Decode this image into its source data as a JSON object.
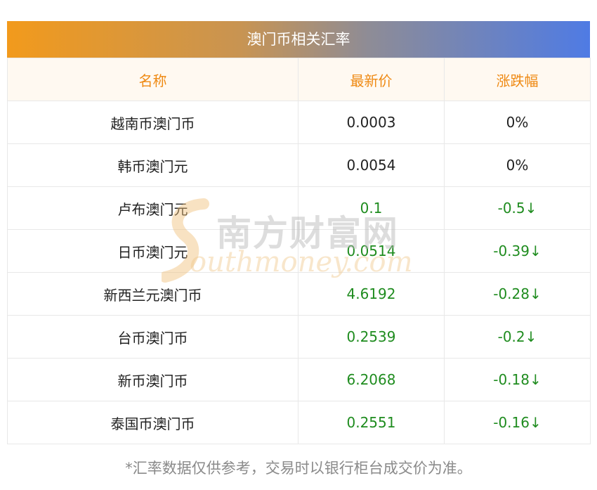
{
  "title": "澳门币相关汇率",
  "columns": [
    "名称",
    "最新价",
    "涨跌幅"
  ],
  "rows": [
    {
      "name": "越南币澳门币",
      "price": "0.0003",
      "change": "0%",
      "trend": "neutral"
    },
    {
      "name": "韩币澳门元",
      "price": "0.0054",
      "change": "0%",
      "trend": "neutral"
    },
    {
      "name": "卢布澳门元",
      "price": "0.1",
      "change": "-0.5↓",
      "trend": "down"
    },
    {
      "name": "日币澳门元",
      "price": "0.0514",
      "change": "-0.39↓",
      "trend": "down"
    },
    {
      "name": "新西兰元澳门币",
      "price": "4.6192",
      "change": "-0.28↓",
      "trend": "down"
    },
    {
      "name": "台币澳门币",
      "price": "0.2539",
      "change": "-0.2↓",
      "trend": "down"
    },
    {
      "name": "新币澳门币",
      "price": "6.2068",
      "change": "-0.18↓",
      "trend": "down"
    },
    {
      "name": "泰国币澳门币",
      "price": "0.2551",
      "change": "-0.16↓",
      "trend": "down"
    }
  ],
  "watermark": {
    "cn": "南方财富网",
    "en": "outhmoney.com"
  },
  "footnote": "*汇率数据仅供参考，交易时以银行柜台成交价为准。",
  "colors": {
    "header_text": "#ef8a14",
    "down": "#1f8c1f",
    "neutral": "#222222"
  }
}
